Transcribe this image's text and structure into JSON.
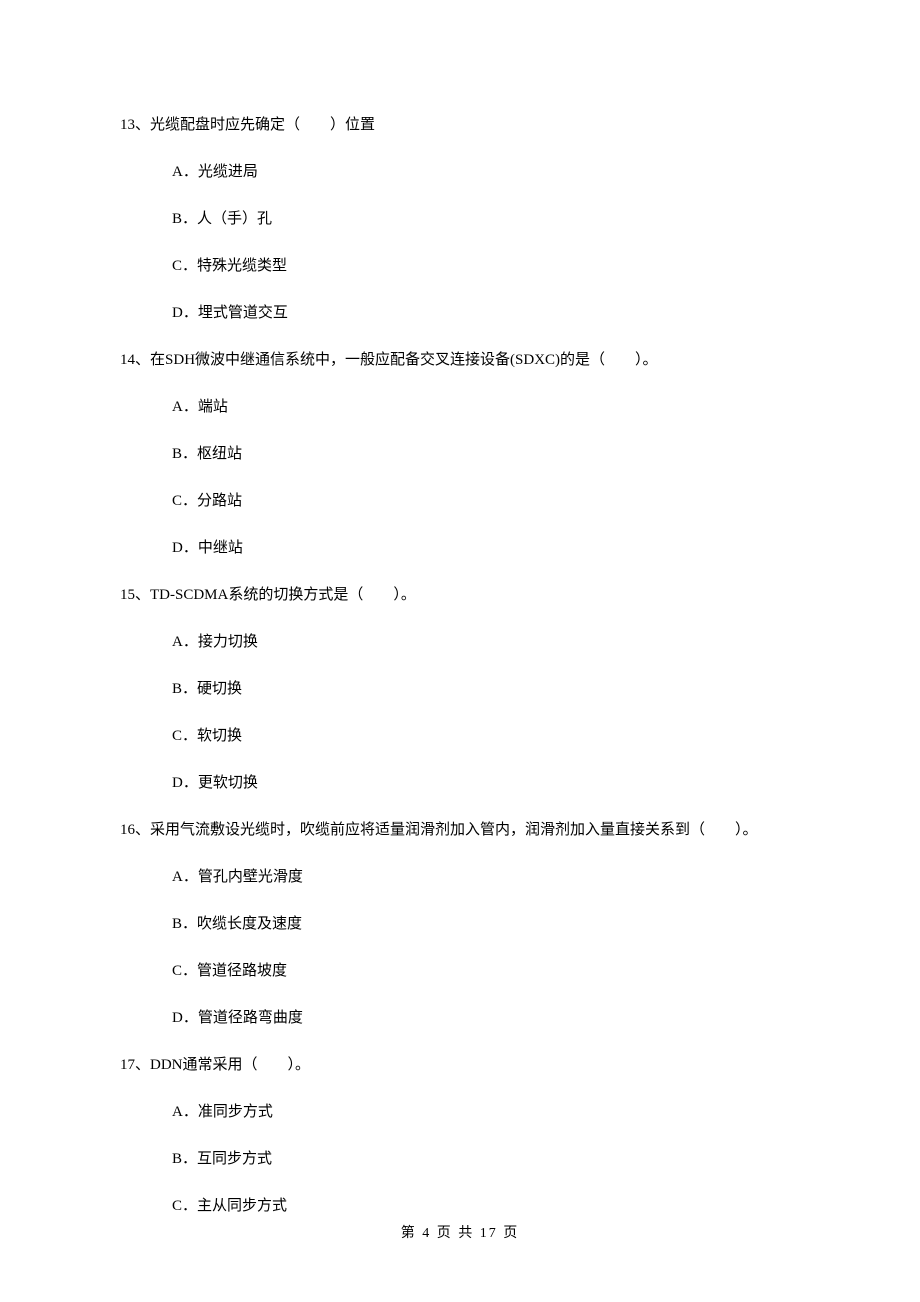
{
  "questions": [
    {
      "num": "13、",
      "text": "光缆配盘时应先确定（　　）位置",
      "options": [
        "A．光缆进局",
        "B．人（手）孔",
        "C．特殊光缆类型",
        "D．埋式管道交互"
      ]
    },
    {
      "num": "14、",
      "text": "在SDH微波中继通信系统中，一般应配备交叉连接设备(SDXC)的是（　　）。",
      "options": [
        "A．端站",
        "B．枢纽站",
        "C．分路站",
        "D．中继站"
      ]
    },
    {
      "num": "15、",
      "text": "TD-SCDMA系统的切换方式是（　　）。",
      "options": [
        "A．接力切换",
        "B．硬切换",
        "C．软切换",
        "D．更软切换"
      ]
    },
    {
      "num": "16、",
      "text": "采用气流敷设光缆时，吹缆前应将适量润滑剂加入管内，润滑剂加入量直接关系到（　　）。",
      "options": [
        "A．管孔内壁光滑度",
        "B．吹缆长度及速度",
        "C．管道径路坡度",
        "D．管道径路弯曲度"
      ]
    },
    {
      "num": "17、",
      "text": "DDN通常采用（　　）。",
      "options": [
        "A．准同步方式",
        "B．互同步方式",
        "C．主从同步方式"
      ]
    }
  ],
  "footer": "第 4 页 共 17 页"
}
